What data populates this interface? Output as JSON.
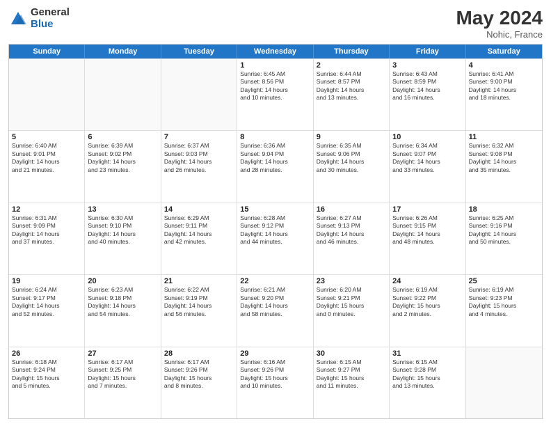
{
  "logo": {
    "general": "General",
    "blue": "Blue"
  },
  "header": {
    "month_year": "May 2024",
    "location": "Nohic, France"
  },
  "days_of_week": [
    "Sunday",
    "Monday",
    "Tuesday",
    "Wednesday",
    "Thursday",
    "Friday",
    "Saturday"
  ],
  "weeks": [
    [
      {
        "day": "",
        "info": ""
      },
      {
        "day": "",
        "info": ""
      },
      {
        "day": "",
        "info": ""
      },
      {
        "day": "1",
        "info": "Sunrise: 6:45 AM\nSunset: 8:56 PM\nDaylight: 14 hours\nand 10 minutes."
      },
      {
        "day": "2",
        "info": "Sunrise: 6:44 AM\nSunset: 8:57 PM\nDaylight: 14 hours\nand 13 minutes."
      },
      {
        "day": "3",
        "info": "Sunrise: 6:43 AM\nSunset: 8:59 PM\nDaylight: 14 hours\nand 16 minutes."
      },
      {
        "day": "4",
        "info": "Sunrise: 6:41 AM\nSunset: 9:00 PM\nDaylight: 14 hours\nand 18 minutes."
      }
    ],
    [
      {
        "day": "5",
        "info": "Sunrise: 6:40 AM\nSunset: 9:01 PM\nDaylight: 14 hours\nand 21 minutes."
      },
      {
        "day": "6",
        "info": "Sunrise: 6:39 AM\nSunset: 9:02 PM\nDaylight: 14 hours\nand 23 minutes."
      },
      {
        "day": "7",
        "info": "Sunrise: 6:37 AM\nSunset: 9:03 PM\nDaylight: 14 hours\nand 26 minutes."
      },
      {
        "day": "8",
        "info": "Sunrise: 6:36 AM\nSunset: 9:04 PM\nDaylight: 14 hours\nand 28 minutes."
      },
      {
        "day": "9",
        "info": "Sunrise: 6:35 AM\nSunset: 9:06 PM\nDaylight: 14 hours\nand 30 minutes."
      },
      {
        "day": "10",
        "info": "Sunrise: 6:34 AM\nSunset: 9:07 PM\nDaylight: 14 hours\nand 33 minutes."
      },
      {
        "day": "11",
        "info": "Sunrise: 6:32 AM\nSunset: 9:08 PM\nDaylight: 14 hours\nand 35 minutes."
      }
    ],
    [
      {
        "day": "12",
        "info": "Sunrise: 6:31 AM\nSunset: 9:09 PM\nDaylight: 14 hours\nand 37 minutes."
      },
      {
        "day": "13",
        "info": "Sunrise: 6:30 AM\nSunset: 9:10 PM\nDaylight: 14 hours\nand 40 minutes."
      },
      {
        "day": "14",
        "info": "Sunrise: 6:29 AM\nSunset: 9:11 PM\nDaylight: 14 hours\nand 42 minutes."
      },
      {
        "day": "15",
        "info": "Sunrise: 6:28 AM\nSunset: 9:12 PM\nDaylight: 14 hours\nand 44 minutes."
      },
      {
        "day": "16",
        "info": "Sunrise: 6:27 AM\nSunset: 9:13 PM\nDaylight: 14 hours\nand 46 minutes."
      },
      {
        "day": "17",
        "info": "Sunrise: 6:26 AM\nSunset: 9:15 PM\nDaylight: 14 hours\nand 48 minutes."
      },
      {
        "day": "18",
        "info": "Sunrise: 6:25 AM\nSunset: 9:16 PM\nDaylight: 14 hours\nand 50 minutes."
      }
    ],
    [
      {
        "day": "19",
        "info": "Sunrise: 6:24 AM\nSunset: 9:17 PM\nDaylight: 14 hours\nand 52 minutes."
      },
      {
        "day": "20",
        "info": "Sunrise: 6:23 AM\nSunset: 9:18 PM\nDaylight: 14 hours\nand 54 minutes."
      },
      {
        "day": "21",
        "info": "Sunrise: 6:22 AM\nSunset: 9:19 PM\nDaylight: 14 hours\nand 56 minutes."
      },
      {
        "day": "22",
        "info": "Sunrise: 6:21 AM\nSunset: 9:20 PM\nDaylight: 14 hours\nand 58 minutes."
      },
      {
        "day": "23",
        "info": "Sunrise: 6:20 AM\nSunset: 9:21 PM\nDaylight: 15 hours\nand 0 minutes."
      },
      {
        "day": "24",
        "info": "Sunrise: 6:19 AM\nSunset: 9:22 PM\nDaylight: 15 hours\nand 2 minutes."
      },
      {
        "day": "25",
        "info": "Sunrise: 6:19 AM\nSunset: 9:23 PM\nDaylight: 15 hours\nand 4 minutes."
      }
    ],
    [
      {
        "day": "26",
        "info": "Sunrise: 6:18 AM\nSunset: 9:24 PM\nDaylight: 15 hours\nand 5 minutes."
      },
      {
        "day": "27",
        "info": "Sunrise: 6:17 AM\nSunset: 9:25 PM\nDaylight: 15 hours\nand 7 minutes."
      },
      {
        "day": "28",
        "info": "Sunrise: 6:17 AM\nSunset: 9:26 PM\nDaylight: 15 hours\nand 8 minutes."
      },
      {
        "day": "29",
        "info": "Sunrise: 6:16 AM\nSunset: 9:26 PM\nDaylight: 15 hours\nand 10 minutes."
      },
      {
        "day": "30",
        "info": "Sunrise: 6:15 AM\nSunset: 9:27 PM\nDaylight: 15 hours\nand 11 minutes."
      },
      {
        "day": "31",
        "info": "Sunrise: 6:15 AM\nSunset: 9:28 PM\nDaylight: 15 hours\nand 13 minutes."
      },
      {
        "day": "",
        "info": ""
      }
    ]
  ]
}
